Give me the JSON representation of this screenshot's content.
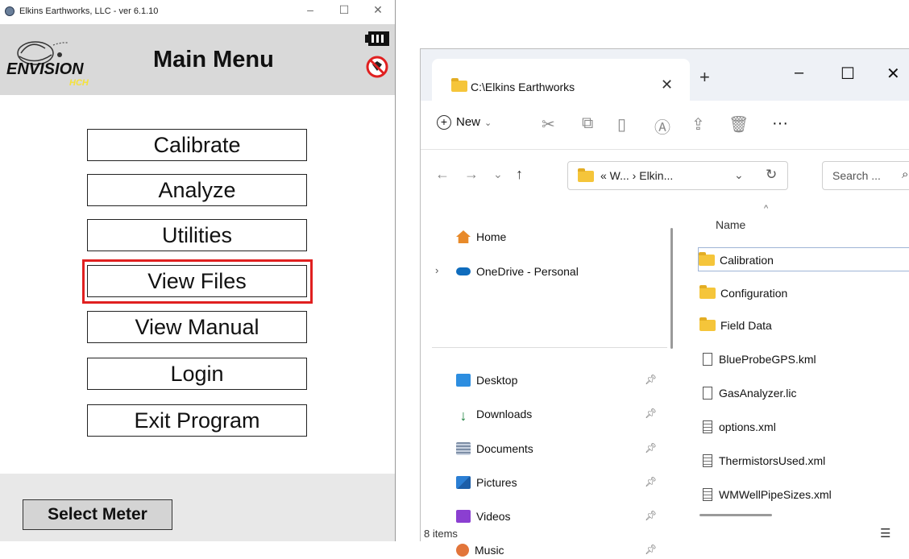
{
  "app": {
    "window_title": "Elkins Earthworks, LLC - ver 6.1.10",
    "header_title": "Main Menu",
    "logo_text": "ENVISION",
    "logo_sub": "HCH",
    "menu": [
      "Calibrate",
      "Analyze",
      "Utilities",
      "View Files",
      "View Manual",
      "Login",
      "Exit Program"
    ],
    "highlighted_item": "View Files",
    "select_meter": "Select Meter",
    "controls": {
      "minimize": "–",
      "maximize": "☐",
      "close": "✕"
    },
    "highlight_color": "#e02020"
  },
  "explorer": {
    "tab_title": "C:\\Elkins Earthworks",
    "tab_close": "✕",
    "new_tab": "+",
    "controls": {
      "minimize": "–",
      "maximize": "☐",
      "close": "✕"
    },
    "toolbar": {
      "new_label": "New",
      "more": "···"
    },
    "address": {
      "path": "« W... › Elkin...",
      "search_placeholder": "Search ..."
    },
    "nav": {
      "home": "Home",
      "onedrive": "OneDrive - Personal",
      "quick": [
        "Desktop",
        "Downloads",
        "Documents",
        "Pictures",
        "Videos",
        "Music"
      ]
    },
    "column_header": "Name",
    "folders": [
      "Calibration",
      "Configuration",
      "Field Data"
    ],
    "files": [
      {
        "name": "BlueProbeGPS.kml",
        "icon": "blank-file-icon"
      },
      {
        "name": "GasAnalyzer.lic",
        "icon": "blank-file-icon"
      },
      {
        "name": "options.xml",
        "icon": "text-file-icon"
      },
      {
        "name": "ThermistorsUsed.xml",
        "icon": "text-file-icon"
      },
      {
        "name": "WMWellPipeSizes.xml",
        "icon": "text-file-icon"
      }
    ],
    "status": "8 items",
    "folder_color": "#f5c53a"
  }
}
